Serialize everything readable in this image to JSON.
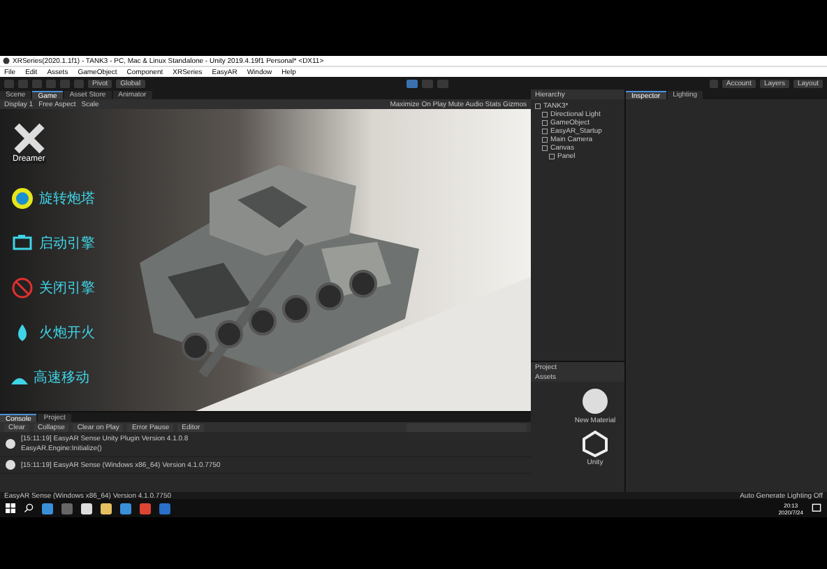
{
  "window": {
    "title": "XRSeries(2020.1.1f1) - TANK3 - PC, Mac & Linux Standalone - Unity 2019.4.19f1 Personal* <DX11>"
  },
  "menu": [
    "File",
    "Edit",
    "Assets",
    "GameObject",
    "Component",
    "XRSeries",
    "EasyAR",
    "Window",
    "Help"
  ],
  "toolbar": {
    "pivot": "Pivot",
    "global": "Global",
    "account": "Account",
    "layers": "Layers",
    "layout": "Layout"
  },
  "scene_tabs": [
    {
      "label": "Scene",
      "selected": false
    },
    {
      "label": "Game",
      "selected": true
    },
    {
      "label": "Asset Store",
      "selected": false
    },
    {
      "label": "Animator",
      "selected": false
    }
  ],
  "game_bar": {
    "display": "Display 1",
    "aspect": "Free Aspect",
    "scale": "Scale",
    "options": "Maximize On Play  Mute Audio  Stats  Gizmos"
  },
  "overlay": {
    "logo": "Dreamer",
    "actions": [
      {
        "label": "旋转炮塔",
        "kind": "turret"
      },
      {
        "label": "启动引擎",
        "kind": "engine"
      },
      {
        "label": "关闭引擎",
        "kind": "stop"
      },
      {
        "label": "火炮开火",
        "kind": "fire"
      },
      {
        "label": "高速移动",
        "kind": "move"
      }
    ]
  },
  "hierarchy": {
    "title": "Hierarchy",
    "items": [
      {
        "label": "TANK3*",
        "children": [
          {
            "label": "Directional Light"
          },
          {
            "label": "GameObject"
          },
          {
            "label": "EasyAR_Startup"
          },
          {
            "label": "Main Camera"
          },
          {
            "label": "Canvas",
            "children": [
              {
                "label": "Panel"
              }
            ]
          }
        ]
      }
    ]
  },
  "inspector_tabs": [
    {
      "label": "Inspector",
      "selected": true
    },
    {
      "label": "Lighting",
      "selected": false
    }
  ],
  "console": {
    "tabs": [
      {
        "label": "Console",
        "selected": true
      },
      {
        "label": "Project",
        "selected": false
      }
    ],
    "buttons": [
      "Clear",
      "Collapse",
      "Clear on Play",
      "Error Pause",
      "Editor"
    ],
    "logs": [
      {
        "line1": "[15:11:19] EasyAR Sense Unity Plugin Version 4.1.0.8",
        "line2": "EasyAR.Engine:Initialize()"
      },
      {
        "line1": "[15:11:19] EasyAR Sense (Windows x86_64) Version 4.1.0.7750"
      }
    ]
  },
  "project": {
    "title": "Project",
    "breadcrumb": "Assets",
    "assets": [
      {
        "label": "New Material",
        "kind": "material"
      },
      {
        "label": "Unity",
        "kind": "logo"
      }
    ]
  },
  "status_bar": {
    "message": "EasyAR Sense (Windows x86_64) Version 4.1.0.7750",
    "right": "Auto Generate Lighting Off"
  },
  "taskbar": {
    "time": "20:13",
    "date": "2020/7/24"
  }
}
